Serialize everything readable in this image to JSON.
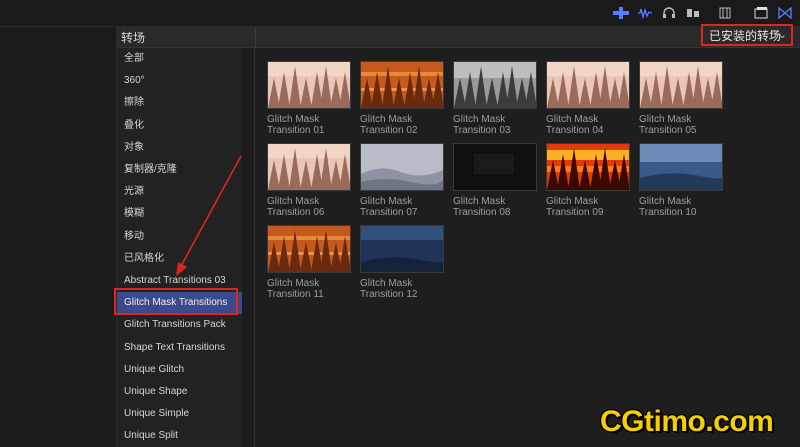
{
  "header": {
    "title": "转场",
    "filter_label": "已安装的转场",
    "filter_chevron": "⌃⌄"
  },
  "sidebar": {
    "items": [
      {
        "label": "全部"
      },
      {
        "label": "360°"
      },
      {
        "label": "擦除"
      },
      {
        "label": "叠化"
      },
      {
        "label": "对象"
      },
      {
        "label": "复制器/克隆"
      },
      {
        "label": "光源"
      },
      {
        "label": "模糊"
      },
      {
        "label": "移动"
      },
      {
        "label": "已风格化"
      },
      {
        "label": "Abstract Transitions 03"
      },
      {
        "label": "Glitch Mask Transitions"
      },
      {
        "label": "Glitch Transitions Pack"
      },
      {
        "label": "Shape Text Transitions"
      },
      {
        "label": "Unique Glitch"
      },
      {
        "label": "Unique Shape"
      },
      {
        "label": "Unique Simple"
      },
      {
        "label": "Unique Split"
      }
    ],
    "selected_index": 11
  },
  "transitions": [
    {
      "line1": "Glitch Mask",
      "line2": "Transition 01",
      "style": "sepia"
    },
    {
      "line1": "Glitch Mask",
      "line2": "Transition 02",
      "style": "orange"
    },
    {
      "line1": "Glitch Mask",
      "line2": "Transition 03",
      "style": "gray"
    },
    {
      "line1": "Glitch Mask",
      "line2": "Transition 04",
      "style": "sepia"
    },
    {
      "line1": "Glitch Mask",
      "line2": "Transition 05",
      "style": "sepia"
    },
    {
      "line1": "Glitch Mask",
      "line2": "Transition 06",
      "style": "sepia"
    },
    {
      "line1": "Glitch Mask",
      "line2": "Transition 07",
      "style": "fog"
    },
    {
      "line1": "Glitch Mask",
      "line2": "Transition 08",
      "style": "dark"
    },
    {
      "line1": "Glitch Mask",
      "line2": "Transition 09",
      "style": "fire"
    },
    {
      "line1": "Glitch Mask",
      "line2": "Transition 10",
      "style": "blue"
    },
    {
      "line1": "Glitch Mask",
      "line2": "Transition 11",
      "style": "orange"
    },
    {
      "line1": "Glitch Mask",
      "line2": "Transition 12",
      "style": "navy"
    }
  ],
  "watermark": "CGtimo.com",
  "colors": {
    "accent_red": "#e0251c",
    "selection_blue": "#3a4a8a",
    "toolbar_blue": "#5a7cff"
  }
}
